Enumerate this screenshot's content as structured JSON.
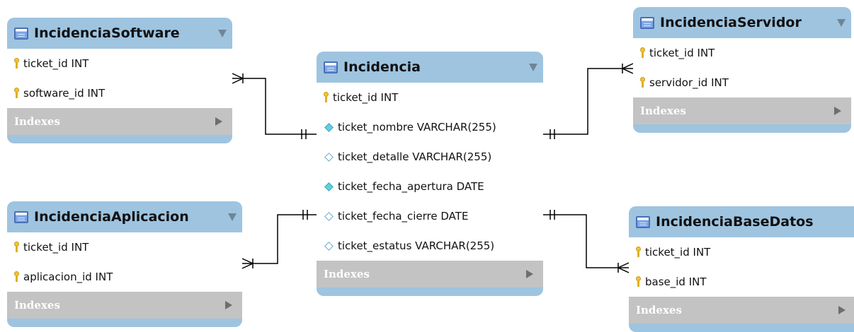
{
  "tables": {
    "incidencia": {
      "name": "Incidencia",
      "columns": [
        {
          "text": "ticket_id INT",
          "icon": "primary-key-icon"
        },
        {
          "text": "ticket_nombre VARCHAR(255)",
          "icon": "filled-diamond-icon"
        },
        {
          "text": "ticket_detalle VARCHAR(255)",
          "icon": "empty-diamond-icon"
        },
        {
          "text": "ticket_fecha_apertura DATE",
          "icon": "filled-diamond-icon"
        },
        {
          "text": "ticket_fecha_cierre DATE",
          "icon": "empty-diamond-icon"
        },
        {
          "text": "ticket_estatus VARCHAR(255)",
          "icon": "empty-diamond-icon"
        }
      ],
      "indexes": "Indexes"
    },
    "software": {
      "name": "IncidenciaSoftware",
      "columns": [
        {
          "text": "ticket_id INT",
          "icon": "primary-key-icon"
        },
        {
          "text": "software_id INT",
          "icon": "primary-key-icon"
        }
      ],
      "indexes": "Indexes"
    },
    "aplicacion": {
      "name": "IncidenciaAplicacion",
      "columns": [
        {
          "text": "ticket_id INT",
          "icon": "primary-key-icon"
        },
        {
          "text": "aplicacion_id INT",
          "icon": "primary-key-icon"
        }
      ],
      "indexes": "Indexes"
    },
    "servidor": {
      "name": "IncidenciaServidor",
      "columns": [
        {
          "text": "ticket_id INT",
          "icon": "primary-key-icon"
        },
        {
          "text": "servidor_id INT",
          "icon": "primary-key-icon"
        }
      ],
      "indexes": "Indexes"
    },
    "basedatos": {
      "name": "IncidenciaBaseDatos",
      "columns": [
        {
          "text": "ticket_id INT",
          "icon": "primary-key-icon"
        },
        {
          "text": "base_id INT",
          "icon": "primary-key-icon"
        }
      ],
      "indexes": "Indexes"
    }
  },
  "relationships": [
    {
      "from": "IncidenciaSoftware",
      "to": "Incidencia",
      "cardinality": "many-to-one"
    },
    {
      "from": "IncidenciaAplicacion",
      "to": "Incidencia",
      "cardinality": "many-to-one"
    },
    {
      "from": "IncidenciaServidor",
      "to": "Incidencia",
      "cardinality": "many-to-one"
    },
    {
      "from": "IncidenciaBaseDatos",
      "to": "Incidencia",
      "cardinality": "many-to-one"
    }
  ],
  "colors": {
    "header": "#9ec4e0",
    "indexes_bar": "#c3c3c3",
    "connector": "#000000"
  }
}
